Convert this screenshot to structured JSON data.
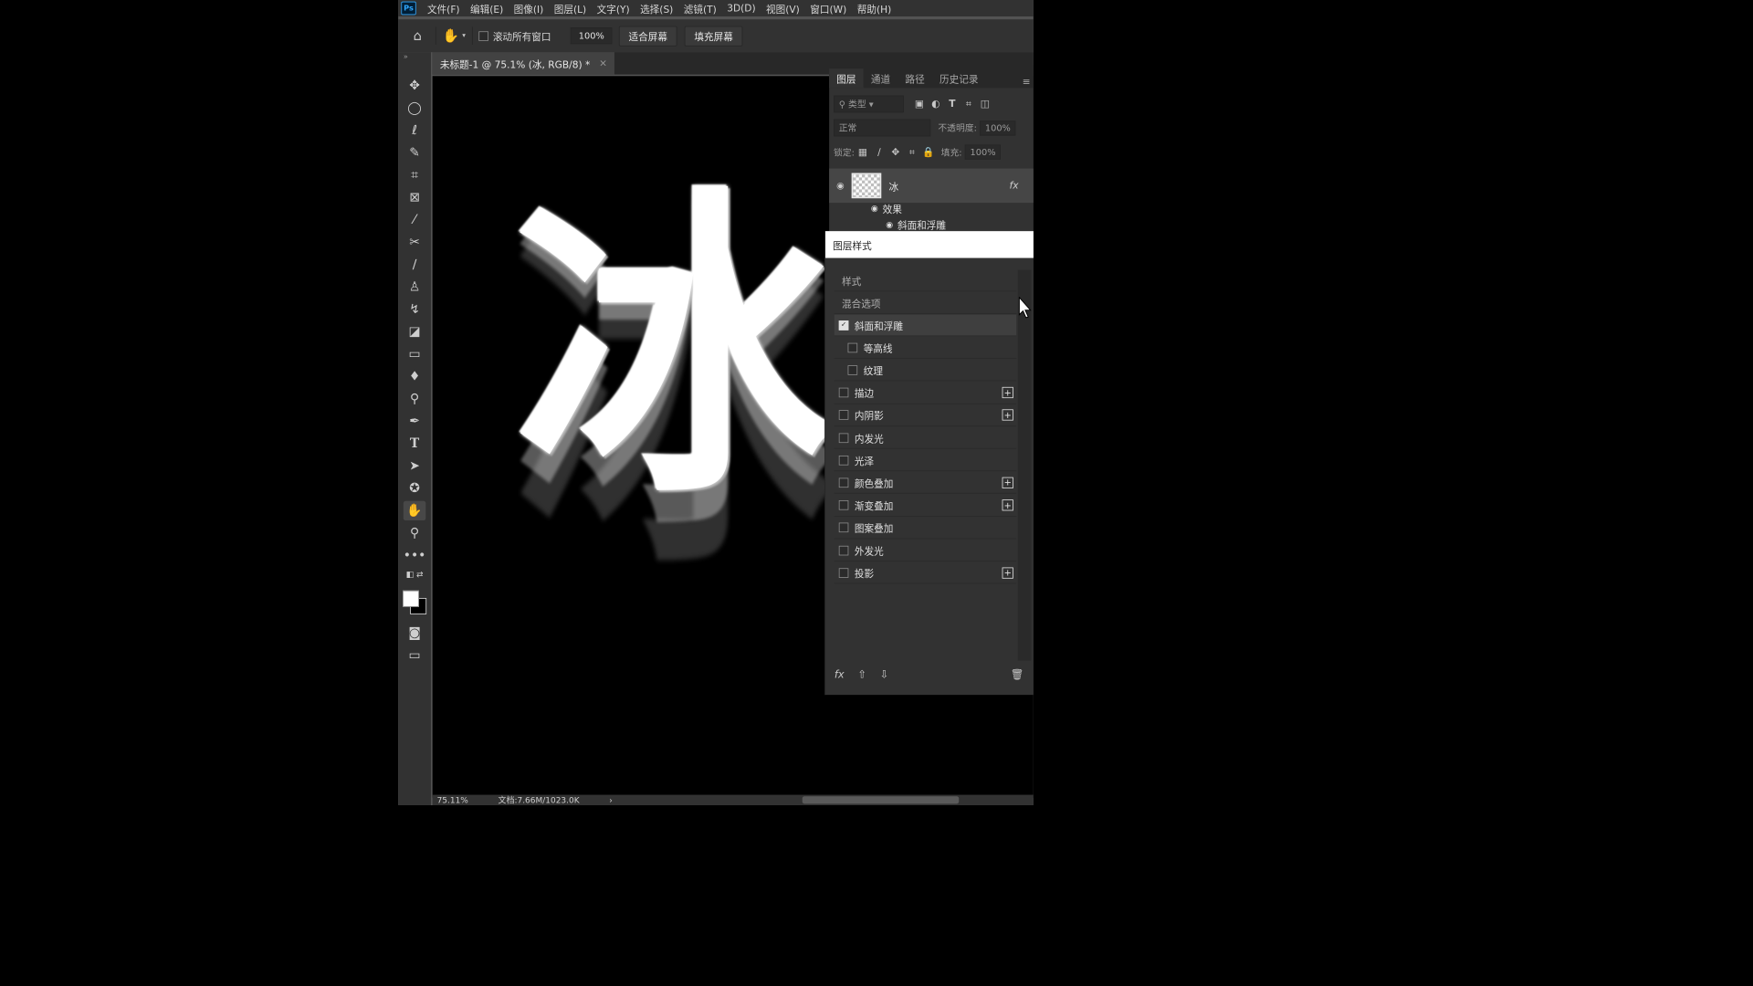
{
  "app": {
    "logo": "Ps"
  },
  "menu": [
    "文件(F)",
    "编辑(E)",
    "图像(I)",
    "图层(L)",
    "文字(Y)",
    "选择(S)",
    "滤镜(T)",
    "3D(D)",
    "视图(V)",
    "窗口(W)",
    "帮助(H)"
  ],
  "options": {
    "scroll_all": "滚动所有窗口",
    "zoom": "100%",
    "fit_screen": "适合屏幕",
    "fill_screen": "填充屏幕"
  },
  "document": {
    "tab_title": "未标题-1 @ 75.1% (冰, RGB/8) *",
    "close": "×",
    "glyph": "冰"
  },
  "status": {
    "zoom": "75.11%",
    "doc": "文档:7.66M/1023.0K",
    "arrow": "›"
  },
  "layers_panel": {
    "tabs": [
      "图层",
      "通道",
      "路径",
      "历史记录"
    ],
    "filter_placeholder": "类型",
    "blend_mode": "正常",
    "opacity_label": "不透明度:",
    "opacity_value": "100%",
    "lock_label": "锁定:",
    "fill_label": "填充:",
    "fill_value": "100%",
    "layer_name": "冰",
    "fx": "fx",
    "effects_label": "效果",
    "effect_item": "斜面和浮雕"
  },
  "layer_style_dialog": {
    "title": "图层样式",
    "styles_header": "样式",
    "blend_options": "混合选项",
    "items": [
      {
        "label": "斜面和浮雕",
        "checked": true,
        "indent": false,
        "plus": false,
        "selected": true
      },
      {
        "label": "等高线",
        "checked": false,
        "indent": true,
        "plus": false,
        "selected": false
      },
      {
        "label": "纹理",
        "checked": false,
        "indent": true,
        "plus": false,
        "selected": false
      },
      {
        "label": "描边",
        "checked": false,
        "indent": false,
        "plus": true,
        "selected": false
      },
      {
        "label": "内阴影",
        "checked": false,
        "indent": false,
        "plus": true,
        "selected": false
      },
      {
        "label": "内发光",
        "checked": false,
        "indent": false,
        "plus": false,
        "selected": false
      },
      {
        "label": "光泽",
        "checked": false,
        "indent": false,
        "plus": false,
        "selected": false
      },
      {
        "label": "颜色叠加",
        "checked": false,
        "indent": false,
        "plus": true,
        "selected": false
      },
      {
        "label": "渐变叠加",
        "checked": false,
        "indent": false,
        "plus": true,
        "selected": false
      },
      {
        "label": "图案叠加",
        "checked": false,
        "indent": false,
        "plus": false,
        "selected": false
      },
      {
        "label": "外发光",
        "checked": false,
        "indent": false,
        "plus": false,
        "selected": false
      },
      {
        "label": "投影",
        "checked": false,
        "indent": false,
        "plus": true,
        "selected": false
      }
    ],
    "footer_fx": "fx"
  }
}
